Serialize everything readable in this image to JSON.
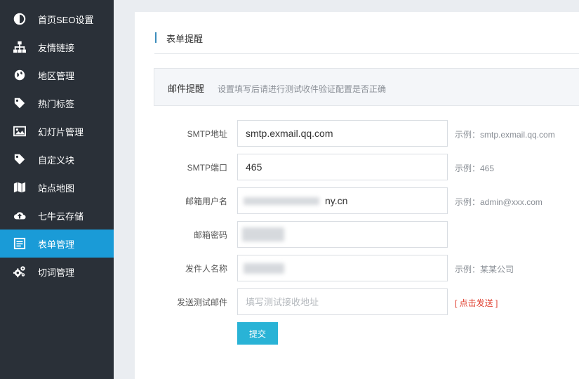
{
  "sidebar": {
    "items": [
      {
        "label": "首页SEO设置",
        "icon": "half-circle-icon",
        "active": false
      },
      {
        "label": "友情链接",
        "icon": "sitemap-icon",
        "active": false
      },
      {
        "label": "地区管理",
        "icon": "globe-icon",
        "active": false
      },
      {
        "label": "热门标签",
        "icon": "tag-icon",
        "active": false
      },
      {
        "label": "幻灯片管理",
        "icon": "image-icon",
        "active": false
      },
      {
        "label": "自定义块",
        "icon": "tag-icon",
        "active": false
      },
      {
        "label": "站点地图",
        "icon": "map-icon",
        "active": false
      },
      {
        "label": "七牛云存储",
        "icon": "cloud-upload-icon",
        "active": false
      },
      {
        "label": "表单管理",
        "icon": "form-icon",
        "active": true
      },
      {
        "label": "切词管理",
        "icon": "gears-icon",
        "active": false
      }
    ]
  },
  "panel": {
    "title": "表单提醒",
    "section_title": "邮件提醒",
    "section_desc": "设置填写后请进行测试收件验证配置是否正确"
  },
  "form": {
    "smtp_host": {
      "label": "SMTP地址",
      "value": "smtp.exmail.qq.com",
      "hint": "示例：smtp.exmail.qq.com"
    },
    "smtp_port": {
      "label": "SMTP端口",
      "value": "465",
      "hint": "示例：465"
    },
    "username": {
      "label": "邮箱用户名",
      "value": "ny.cn",
      "hint": "示例：admin@xxx.com"
    },
    "password": {
      "label": "邮箱密码",
      "value": ""
    },
    "sender_name": {
      "label": "发件人名称",
      "value": "",
      "hint": "示例：某某公司"
    },
    "test_email": {
      "label": "发送测试邮件",
      "placeholder": "填写测试接收地址",
      "action": "[ 点击发送 ]"
    },
    "submit_label": "提交"
  },
  "colors": {
    "sidebar_bg": "#2a3038",
    "active_bg": "#1a9bd7",
    "submit_bg": "#29b3d6",
    "link_red": "#e04030"
  }
}
